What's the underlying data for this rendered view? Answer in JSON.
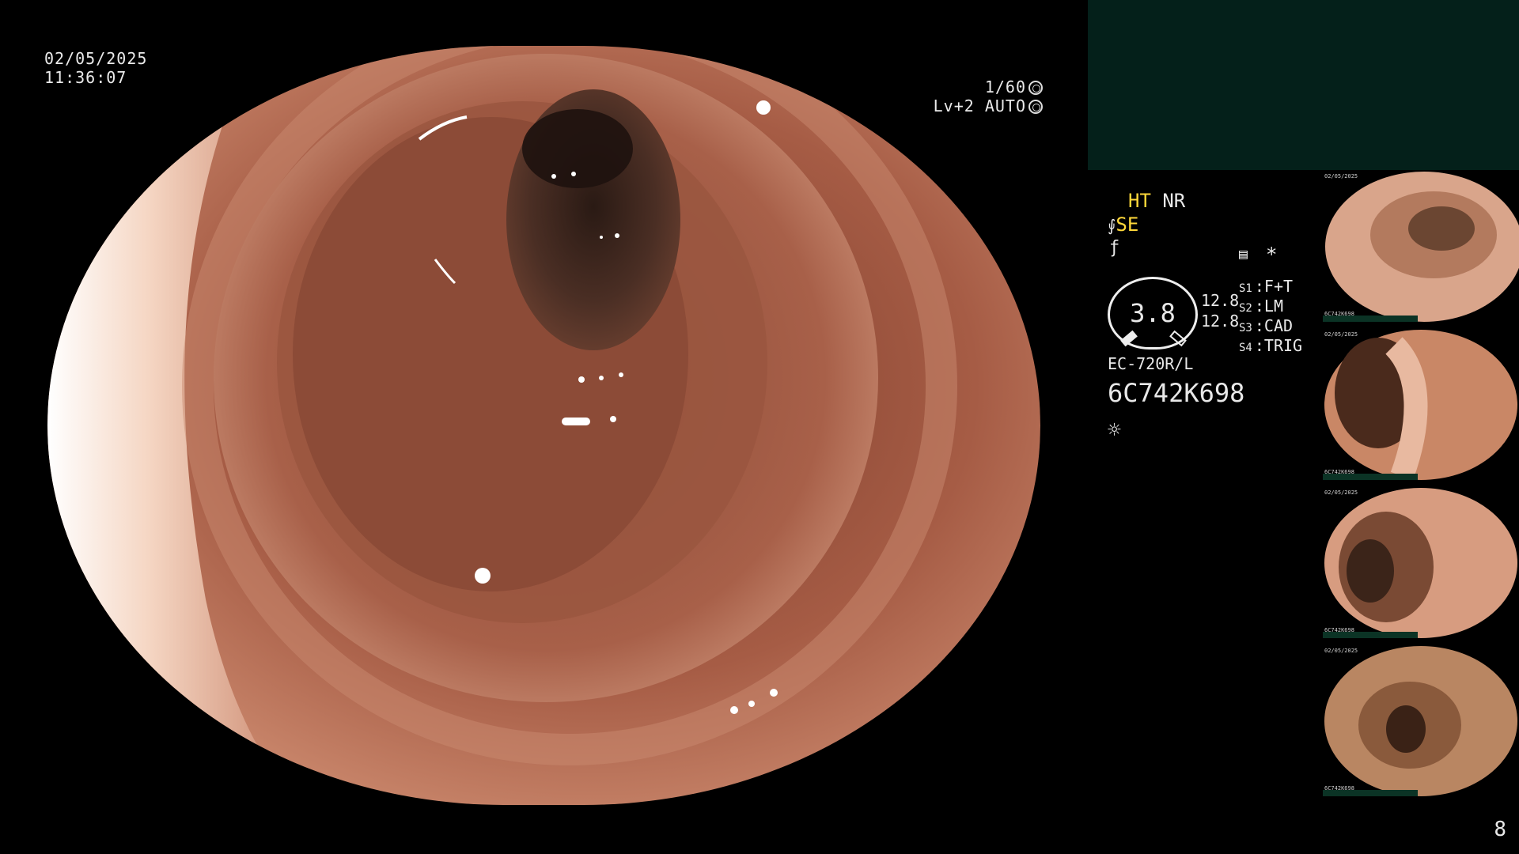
{
  "overlay": {
    "date": "02/05/2025",
    "time": "11:36:07",
    "shutter": "1/60",
    "level": "Lv+2",
    "exposure": "AUTO"
  },
  "status": {
    "ht": "HT",
    "nr": "NR",
    "se": "SE",
    "zoom": "3.8",
    "val_top": "12.8",
    "val_bottom": "12.8",
    "switches": [
      {
        "key": "S1",
        "label": "F+T"
      },
      {
        "key": "S2",
        "label": "LM"
      },
      {
        "key": "S3",
        "label": "CAD"
      },
      {
        "key": "S4",
        "label": "TRIG"
      }
    ],
    "scope_model": "EC-720R/L",
    "serial": "6C742K698",
    "asterisk": "*"
  },
  "thumb_meta": {
    "date": "02/05/2025",
    "serial": "6C742K698"
  },
  "page_number": "8",
  "colors": {
    "panel_teal": "#04201a",
    "highlight_yellow": "#ffd83a",
    "mucosa": "#b06a50"
  },
  "icons": [
    "shutter-icon",
    "auto-exposure-icon",
    "scope-bend-icon",
    "freeze-icon",
    "memory-icon",
    "light-icon"
  ]
}
